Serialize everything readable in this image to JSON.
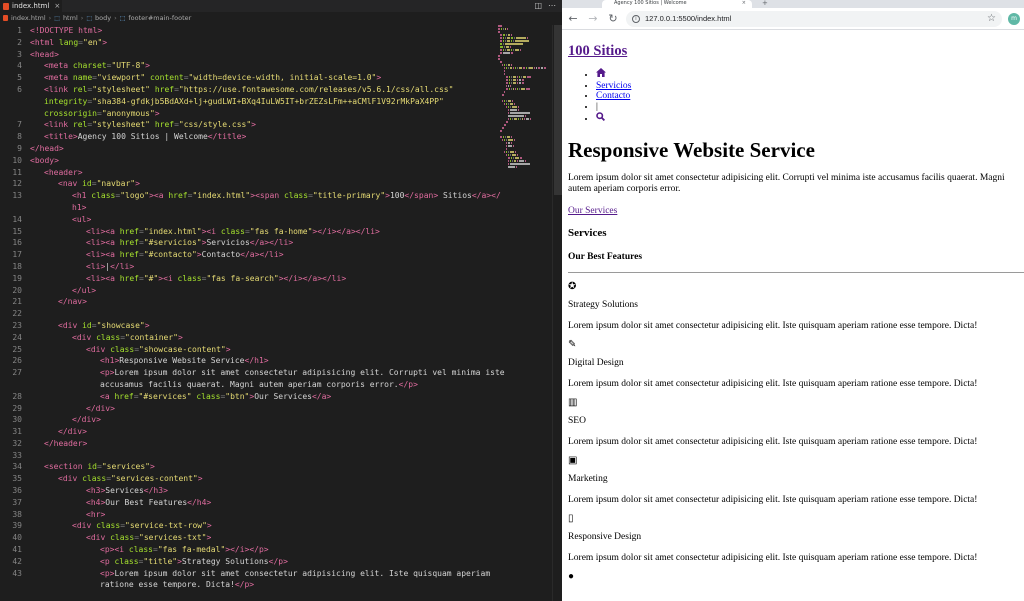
{
  "editor": {
    "tab_label": "index.html",
    "tab_close": "×",
    "breadcrumb": [
      "index.html",
      "html",
      "body",
      "footer#main-footer"
    ],
    "lines": [
      {
        "n": "1",
        "ind": 0,
        "tokens": [
          [
            "doc",
            "<!DOCTYPE html>"
          ]
        ]
      },
      {
        "n": "2",
        "ind": 0,
        "tokens": [
          [
            "tag",
            "<html "
          ],
          [
            "attr",
            "lang"
          ],
          [
            "punc",
            "="
          ],
          [
            "str",
            "\"en\""
          ],
          [
            "tag",
            ">"
          ]
        ]
      },
      {
        "n": "3",
        "ind": 0,
        "tokens": [
          [
            "tag",
            "<head>"
          ]
        ]
      },
      {
        "n": "4",
        "ind": 1,
        "tokens": [
          [
            "tag",
            "<meta "
          ],
          [
            "attr",
            "charset"
          ],
          [
            "punc",
            "="
          ],
          [
            "str",
            "\"UTF-8\""
          ],
          [
            "tag",
            ">"
          ]
        ]
      },
      {
        "n": "5",
        "ind": 1,
        "tokens": [
          [
            "tag",
            "<meta "
          ],
          [
            "attr",
            "name"
          ],
          [
            "punc",
            "="
          ],
          [
            "str",
            "\"viewport\" "
          ],
          [
            "attr",
            "content"
          ],
          [
            "punc",
            "="
          ],
          [
            "str",
            "\"width=device-width, initial-scale=1.0\""
          ],
          [
            "tag",
            ">"
          ]
        ]
      },
      {
        "n": "6",
        "ind": 1,
        "tokens": [
          [
            "tag",
            "<link "
          ],
          [
            "attr",
            "rel"
          ],
          [
            "punc",
            "="
          ],
          [
            "str",
            "\"stylesheet\" "
          ],
          [
            "attr",
            "href"
          ],
          [
            "punc",
            "="
          ],
          [
            "str",
            "\"https://use.fontawesome.com/releases/v5.6.1/css/all.css\""
          ]
        ]
      },
      {
        "n": "",
        "ind": 1,
        "tokens": [
          [
            "attr",
            "integrity"
          ],
          [
            "punc",
            "="
          ],
          [
            "str",
            "\"sha384-gfdkjb5BdAXd+lj+gudLWI+BXq4IuLW5IT+brZEZsLFm++aCMlF1V92rMkPaX4PP\""
          ]
        ]
      },
      {
        "n": "",
        "ind": 1,
        "tokens": [
          [
            "attr",
            "crossorigin"
          ],
          [
            "punc",
            "="
          ],
          [
            "str",
            "\"anonymous\""
          ],
          [
            "tag",
            ">"
          ]
        ]
      },
      {
        "n": "7",
        "ind": 1,
        "tokens": [
          [
            "tag",
            "<link "
          ],
          [
            "attr",
            "rel"
          ],
          [
            "punc",
            "="
          ],
          [
            "str",
            "\"stylesheet\" "
          ],
          [
            "attr",
            "href"
          ],
          [
            "punc",
            "="
          ],
          [
            "str",
            "\"css/style.css\""
          ],
          [
            "tag",
            ">"
          ]
        ]
      },
      {
        "n": "8",
        "ind": 1,
        "tokens": [
          [
            "tag",
            "<title>"
          ],
          [
            "text",
            "Agency 100 Sitios | Welcome"
          ],
          [
            "tag",
            "</title>"
          ]
        ]
      },
      {
        "n": "9",
        "ind": 0,
        "tokens": [
          [
            "tag",
            "</head>"
          ]
        ]
      },
      {
        "n": "10",
        "ind": 0,
        "tokens": [
          [
            "tag",
            "<body>"
          ]
        ]
      },
      {
        "n": "11",
        "ind": 1,
        "tokens": [
          [
            "tag",
            "<header>"
          ]
        ]
      },
      {
        "n": "12",
        "ind": 2,
        "tokens": [
          [
            "tag",
            "<nav "
          ],
          [
            "attr",
            "id"
          ],
          [
            "punc",
            "="
          ],
          [
            "str",
            "\"navbar\""
          ],
          [
            "tag",
            ">"
          ]
        ]
      },
      {
        "n": "13",
        "ind": 3,
        "tokens": [
          [
            "tag",
            "<h1 "
          ],
          [
            "attr",
            "class"
          ],
          [
            "punc",
            "="
          ],
          [
            "str",
            "\"logo\""
          ],
          [
            "tag",
            "><a "
          ],
          [
            "attr",
            "href"
          ],
          [
            "punc",
            "="
          ],
          [
            "str",
            "\"index.html\""
          ],
          [
            "tag",
            "><span "
          ],
          [
            "attr",
            "class"
          ],
          [
            "punc",
            "="
          ],
          [
            "str",
            "\"title-primary\""
          ],
          [
            "tag",
            ">"
          ],
          [
            "text",
            "100"
          ],
          [
            "tag",
            "</span>"
          ],
          [
            "text",
            " Sitios"
          ],
          [
            "tag",
            "</a></"
          ]
        ]
      },
      {
        "n": "",
        "ind": 3,
        "tokens": [
          [
            "tag",
            "h1>"
          ]
        ]
      },
      {
        "n": "14",
        "ind": 3,
        "tokens": [
          [
            "tag",
            "<ul>"
          ]
        ]
      },
      {
        "n": "15",
        "ind": 4,
        "tokens": [
          [
            "tag",
            "<li><a "
          ],
          [
            "attr",
            "href"
          ],
          [
            "punc",
            "="
          ],
          [
            "str",
            "\"index.html\""
          ],
          [
            "tag",
            "><i "
          ],
          [
            "attr",
            "class"
          ],
          [
            "punc",
            "="
          ],
          [
            "str",
            "\"fas fa-home\""
          ],
          [
            "tag",
            "></i></a></li>"
          ]
        ]
      },
      {
        "n": "16",
        "ind": 4,
        "tokens": [
          [
            "tag",
            "<li><a "
          ],
          [
            "attr",
            "href"
          ],
          [
            "punc",
            "="
          ],
          [
            "str",
            "\"#servicios\""
          ],
          [
            "tag",
            ">"
          ],
          [
            "text",
            "Servicios"
          ],
          [
            "tag",
            "</a></li>"
          ]
        ]
      },
      {
        "n": "17",
        "ind": 4,
        "tokens": [
          [
            "tag",
            "<li><a "
          ],
          [
            "attr",
            "href"
          ],
          [
            "punc",
            "="
          ],
          [
            "str",
            "\"#contacto\""
          ],
          [
            "tag",
            ">"
          ],
          [
            "text",
            "Contacto"
          ],
          [
            "tag",
            "</a></li>"
          ]
        ]
      },
      {
        "n": "18",
        "ind": 4,
        "tokens": [
          [
            "tag",
            "<li>"
          ],
          [
            "text",
            "|"
          ],
          [
            "tag",
            "</li>"
          ]
        ]
      },
      {
        "n": "19",
        "ind": 4,
        "tokens": [
          [
            "tag",
            "<li><a "
          ],
          [
            "attr",
            "href"
          ],
          [
            "punc",
            "="
          ],
          [
            "str",
            "\"#\""
          ],
          [
            "tag",
            "><i "
          ],
          [
            "attr",
            "class"
          ],
          [
            "punc",
            "="
          ],
          [
            "str",
            "\"fas fa-search\""
          ],
          [
            "tag",
            "></i></a></li>"
          ]
        ]
      },
      {
        "n": "20",
        "ind": 3,
        "tokens": [
          [
            "tag",
            "</ul>"
          ]
        ]
      },
      {
        "n": "21",
        "ind": 2,
        "tokens": [
          [
            "tag",
            "</nav>"
          ]
        ]
      },
      {
        "n": "22",
        "ind": 0,
        "tokens": []
      },
      {
        "n": "23",
        "ind": 2,
        "tokens": [
          [
            "tag",
            "<div "
          ],
          [
            "attr",
            "id"
          ],
          [
            "punc",
            "="
          ],
          [
            "str",
            "\"showcase\""
          ],
          [
            "tag",
            ">"
          ]
        ]
      },
      {
        "n": "24",
        "ind": 3,
        "tokens": [
          [
            "tag",
            "<div "
          ],
          [
            "attr",
            "class"
          ],
          [
            "punc",
            "="
          ],
          [
            "str",
            "\"container\""
          ],
          [
            "tag",
            ">"
          ]
        ]
      },
      {
        "n": "25",
        "ind": 4,
        "tokens": [
          [
            "tag",
            "<div "
          ],
          [
            "attr",
            "class"
          ],
          [
            "punc",
            "="
          ],
          [
            "str",
            "\"showcase-content\""
          ],
          [
            "tag",
            ">"
          ]
        ]
      },
      {
        "n": "26",
        "ind": 5,
        "tokens": [
          [
            "tag",
            "<h1>"
          ],
          [
            "text",
            "Responsive Website Service"
          ],
          [
            "tag",
            "</h1>"
          ]
        ]
      },
      {
        "n": "27",
        "ind": 5,
        "tokens": [
          [
            "tag",
            "<p>"
          ],
          [
            "text",
            "Lorem ipsum dolor sit amet consectetur adipisicing elit. Corrupti vel minima iste"
          ]
        ]
      },
      {
        "n": "",
        "ind": 5,
        "tokens": [
          [
            "text",
            "accusamus facilis quaerat. Magni autem aperiam corporis error."
          ],
          [
            "tag",
            "</p>"
          ]
        ]
      },
      {
        "n": "28",
        "ind": 5,
        "tokens": [
          [
            "tag",
            "<a "
          ],
          [
            "attr",
            "href"
          ],
          [
            "punc",
            "="
          ],
          [
            "str",
            "\"#services\" "
          ],
          [
            "attr",
            "class"
          ],
          [
            "punc",
            "="
          ],
          [
            "str",
            "\"btn\""
          ],
          [
            "tag",
            ">"
          ],
          [
            "text",
            "Our Services"
          ],
          [
            "tag",
            "</a>"
          ]
        ]
      },
      {
        "n": "29",
        "ind": 4,
        "tokens": [
          [
            "tag",
            "</div>"
          ]
        ]
      },
      {
        "n": "30",
        "ind": 3,
        "tokens": [
          [
            "tag",
            "</div>"
          ]
        ]
      },
      {
        "n": "31",
        "ind": 2,
        "tokens": [
          [
            "tag",
            "</div>"
          ]
        ]
      },
      {
        "n": "32",
        "ind": 1,
        "tokens": [
          [
            "tag",
            "</header>"
          ]
        ]
      },
      {
        "n": "33",
        "ind": 0,
        "tokens": []
      },
      {
        "n": "34",
        "ind": 1,
        "tokens": [
          [
            "tag",
            "<section "
          ],
          [
            "attr",
            "id"
          ],
          [
            "punc",
            "="
          ],
          [
            "str",
            "\"services\""
          ],
          [
            "tag",
            ">"
          ]
        ]
      },
      {
        "n": "35",
        "ind": 2,
        "tokens": [
          [
            "tag",
            "<div "
          ],
          [
            "attr",
            "class"
          ],
          [
            "punc",
            "="
          ],
          [
            "str",
            "\"services-content\""
          ],
          [
            "tag",
            ">"
          ]
        ]
      },
      {
        "n": "36",
        "ind": 4,
        "tokens": [
          [
            "tag",
            "<h3>"
          ],
          [
            "text",
            "Services"
          ],
          [
            "tag",
            "</h3>"
          ]
        ]
      },
      {
        "n": "37",
        "ind": 4,
        "tokens": [
          [
            "tag",
            "<h4>"
          ],
          [
            "text",
            "Our Best Features"
          ],
          [
            "tag",
            "</h4>"
          ]
        ]
      },
      {
        "n": "38",
        "ind": 4,
        "tokens": [
          [
            "tag",
            "<hr>"
          ]
        ]
      },
      {
        "n": "39",
        "ind": 3,
        "tokens": [
          [
            "tag",
            "<div "
          ],
          [
            "attr",
            "class"
          ],
          [
            "punc",
            "="
          ],
          [
            "str",
            "\"service-txt-row\""
          ],
          [
            "tag",
            ">"
          ]
        ]
      },
      {
        "n": "40",
        "ind": 4,
        "tokens": [
          [
            "tag",
            "<div "
          ],
          [
            "attr",
            "class"
          ],
          [
            "punc",
            "="
          ],
          [
            "str",
            "\"services-txt\""
          ],
          [
            "tag",
            ">"
          ]
        ]
      },
      {
        "n": "41",
        "ind": 5,
        "tokens": [
          [
            "tag",
            "<p><i "
          ],
          [
            "attr",
            "class"
          ],
          [
            "punc",
            "="
          ],
          [
            "str",
            "\"fas fa-medal\""
          ],
          [
            "tag",
            "></i></p>"
          ]
        ]
      },
      {
        "n": "42",
        "ind": 5,
        "tokens": [
          [
            "tag",
            "<p "
          ],
          [
            "attr",
            "class"
          ],
          [
            "punc",
            "="
          ],
          [
            "str",
            "\"title\""
          ],
          [
            "tag",
            ">"
          ],
          [
            "text",
            "Strategy Solutions"
          ],
          [
            "tag",
            "</p>"
          ]
        ]
      },
      {
        "n": "43",
        "ind": 5,
        "tokens": [
          [
            "tag",
            "<p>"
          ],
          [
            "text",
            "Lorem ipsum dolor sit amet consectetur adipisicing elit. Iste quisquam aperiam"
          ]
        ]
      },
      {
        "n": "",
        "ind": 5,
        "tokens": [
          [
            "text",
            "ratione esse tempore. Dicta!"
          ],
          [
            "tag",
            "</p>"
          ]
        ]
      }
    ]
  },
  "browser": {
    "tab_title": "Agency 100 Sitios | Welcome",
    "new_tab": "+",
    "url": "127.0.0.1:5500/index.html",
    "back": "←",
    "forward": "→",
    "reload": "↻",
    "star": "☆",
    "profile_letter": "m"
  },
  "page": {
    "logo": "100 Sitios",
    "nav": {
      "home_icon": "home-icon",
      "servicios": "Servicios",
      "contacto": "Contacto",
      "separator": "|",
      "search_icon": "search-icon"
    },
    "showcase": {
      "title": "Responsive Website Service",
      "text": "Lorem ipsum dolor sit amet consectetur adipisicing elit. Corrupti vel minima iste accusamus facilis quaerat. Magni autem aperiam corporis error.",
      "link": "Our Services"
    },
    "services": {
      "heading": "Services",
      "subheading": "Our Best Features",
      "items": [
        {
          "icon": "medal-icon",
          "glyph": "✪",
          "title": "Strategy Solutions",
          "text": "Lorem ipsum dolor sit amet consectetur adipisicing elit. Iste quisquam aperiam ratione esse tempore. Dicta!"
        },
        {
          "icon": "pencil-icon",
          "glyph": "✎",
          "title": "Digital Design",
          "text": "Lorem ipsum dolor sit amet consectetur adipisicing elit. Iste quisquam aperiam ratione esse tempore. Dicta!"
        },
        {
          "icon": "chart-icon",
          "glyph": "▥",
          "title": "SEO",
          "text": "Lorem ipsum dolor sit amet consectetur adipisicing elit. Iste quisquam aperiam ratione esse tempore. Dicta!"
        },
        {
          "icon": "ad-icon",
          "glyph": "▣",
          "title": "Marketing",
          "text": "Lorem ipsum dolor sit amet consectetur adipisicing elit. Iste quisquam aperiam ratione esse tempore. Dicta!"
        },
        {
          "icon": "mobile-icon",
          "glyph": "▯",
          "title": "Responsive Design",
          "text": "Lorem ipsum dolor sit amet consectetur adipisicing elit. Iste quisquam aperiam ratione esse tempore. Dicta!"
        },
        {
          "icon": "user-icon",
          "glyph": "●",
          "title": "",
          "text": ""
        }
      ]
    }
  },
  "colors": {
    "tag": "#e06c9f",
    "attr": "#a6e22e",
    "string": "#e6db74",
    "text": "#d4d4d4",
    "visited_link": "#551a8b",
    "link": "#0000ee"
  }
}
